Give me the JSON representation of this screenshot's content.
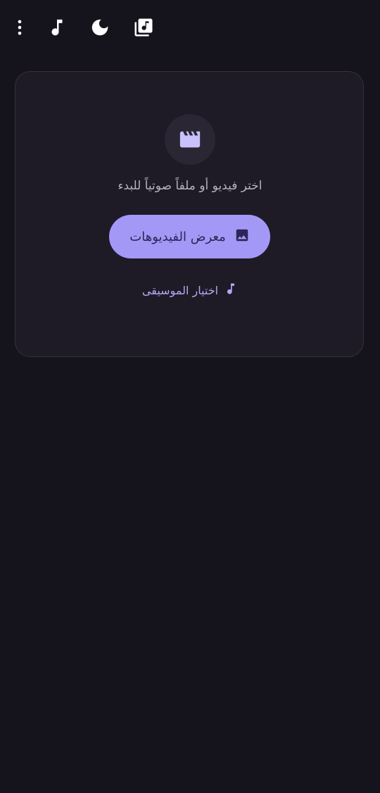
{
  "toolbar": {
    "icons": [
      "more-vertical-icon",
      "music-note-icon",
      "dark-mode-moon-icon",
      "music-library-icon"
    ]
  },
  "picker": {
    "hero_icon": "movie-clapperboard-icon",
    "prompt": "اختر فيديو أو ملفاً صوتياً للبدء",
    "gallery_button": {
      "label": "معرض الفيديوهات",
      "icon": "image-icon"
    },
    "music_link": {
      "label": "اختيار الموسيقى",
      "icon": "music-note-icon"
    }
  },
  "colors": {
    "background": "#15131c",
    "card": "#1e1b27",
    "accent": "#a498f7",
    "accent_text": "#2e2557",
    "link": "#b4a8f5"
  }
}
